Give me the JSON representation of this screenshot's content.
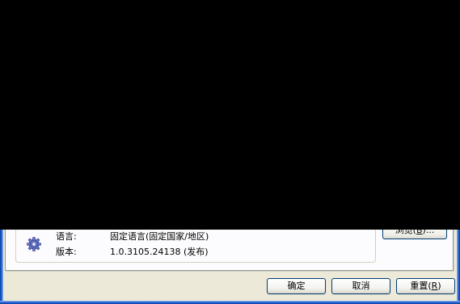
{
  "info": {
    "language_label": "语言:",
    "language_value": "固定语言(固定国家/地区)",
    "version_label": "版本:",
    "version_value": "1.0.3105.24138 (发布)"
  },
  "browse_button": {
    "label": "浏览(",
    "mnemonic": "B",
    "suffix": ")..."
  },
  "buttons": {
    "ok_label": "确定",
    "cancel_label": "取消",
    "reset_label": "重置(",
    "reset_mnemonic": "R",
    "reset_suffix": ")"
  },
  "icons": {
    "settings": "gear-icon"
  },
  "colors": {
    "frame_blue": "#0a3ea8",
    "dialog_bg": "#ece9d8",
    "overlay": "#000000"
  }
}
